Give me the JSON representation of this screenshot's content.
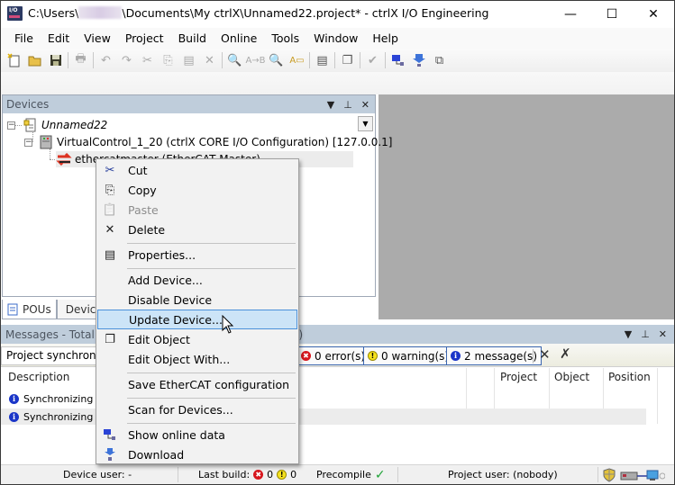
{
  "window": {
    "title_prefix": "C:\\Users\\",
    "title_suffix": "\\Documents\\My ctrlX\\Unnamed22.project* - ctrlX I/O Engineering",
    "minimize": "—",
    "maximize": "☐",
    "close": "✕"
  },
  "menubar": [
    "File",
    "Edit",
    "View",
    "Project",
    "Build",
    "Online",
    "Tools",
    "Window",
    "Help"
  ],
  "toolbar": {
    "icons": [
      "new-project-icon",
      "open-folder-icon",
      "save-icon",
      "print-icon",
      "undo-icon",
      "redo-icon",
      "cut-icon",
      "copy-icon",
      "paste-icon",
      "delete-icon",
      "find-icon",
      "replace-icon",
      "find-in-project-icon",
      "replace-in-project-icon",
      "properties-icon",
      "open-object-icon",
      "compile-check-icon",
      "online-data-icon",
      "download-icon",
      "duplicate-icon"
    ]
  },
  "devices_panel": {
    "title": "Devices",
    "ctrl_dropdown": "▼",
    "ctrl_pin": "⊥",
    "ctrl_close": "✕",
    "tree": [
      {
        "label": "Unnamed22",
        "italic": true
      },
      {
        "label": "VirtualControl_1_20 (ctrlX CORE I/O Configuration) [127.0.0.1]"
      },
      {
        "label": "ethercatmaster (EtherCAT Master)"
      }
    ]
  },
  "bottom_tabs": [
    {
      "label": "POUs"
    },
    {
      "label": "Devices"
    }
  ],
  "messages_panel": {
    "title": "Messages - Total 0 error(s), 0 warning(s), 2 message(s)",
    "category": "Project synchronization",
    "filters": {
      "errors": "0 error(s)",
      "warnings": "0 warning(s)",
      "messages": "2 message(s)"
    },
    "columns": [
      "Description",
      "Project",
      "Object",
      "Position"
    ],
    "rows": [
      {
        "description": "Synchronizing the project with the PLC."
      },
      {
        "description": "Synchronizing the project was successful. Online view."
      }
    ]
  },
  "context_menu": {
    "items": [
      {
        "label": "Cut",
        "icon": "✂",
        "disabled": false
      },
      {
        "label": "Copy",
        "icon": "⎘",
        "disabled": false
      },
      {
        "label": "Paste",
        "icon": "📋",
        "disabled": true
      },
      {
        "label": "Delete",
        "icon": "✕",
        "disabled": false
      },
      {
        "label": "Properties...",
        "icon": "▤",
        "disabled": false
      },
      {
        "label": "Add Device...",
        "icon": "",
        "disabled": false
      },
      {
        "label": "Disable Device",
        "icon": "",
        "disabled": false
      },
      {
        "label": "Update Device...",
        "icon": "",
        "disabled": false,
        "highlighted": true
      },
      {
        "label": "Edit Object",
        "icon": "❐",
        "disabled": false
      },
      {
        "label": "Edit Object With...",
        "icon": "",
        "disabled": false
      },
      {
        "label": "Save EtherCAT configuration",
        "icon": "",
        "disabled": false
      },
      {
        "label": "Scan for Devices...",
        "icon": "",
        "disabled": false
      },
      {
        "label": "Show online data",
        "icon": "▣",
        "disabled": false
      },
      {
        "label": "Download",
        "icon": "⬇",
        "disabled": false
      }
    ]
  },
  "statusbar": {
    "device_user": "Device user: -",
    "last_build_label": "Last build:",
    "last_build_errors": "0",
    "last_build_warnings": "0",
    "precompile_label": "Precompile",
    "precompile_status": "✓",
    "project_user": "Project user: (nobody)"
  },
  "colors": {
    "panel_header": "#bfcddb",
    "highlight": "#cce4f7",
    "highlight_border": "#4a90d9",
    "error": "#d7161d",
    "warning": "#f6e21f",
    "info": "#1a35c8",
    "precompile_ok": "#1fa336"
  }
}
